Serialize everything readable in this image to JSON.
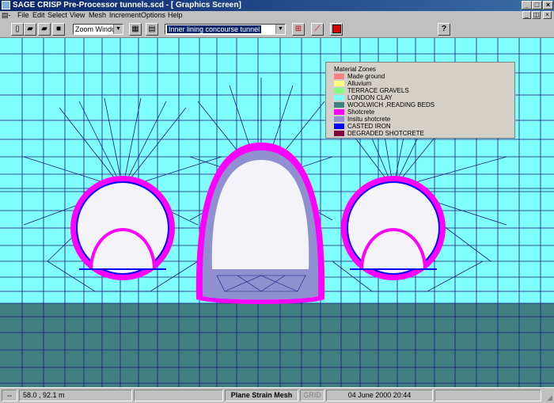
{
  "window": {
    "title": "SAGE CRISP Pre-Processor tunnels.scd - [ Graphics Screen]"
  },
  "menu": [
    "File",
    "Edit",
    "Select",
    "View",
    "Mesh",
    "Increment",
    "Options",
    "Help"
  ],
  "toolbar": {
    "zoom_value": "Zoom Window",
    "zone_value": "Inner lining concourse tunnel",
    "help_icon": "?"
  },
  "legend": {
    "title": "Material Zones",
    "items": [
      {
        "label": "Made ground",
        "color": "#ff8080"
      },
      {
        "label": "Alluvium",
        "color": "#ffff80"
      },
      {
        "label": "TERRACE GRAVELS",
        "color": "#80ff80"
      },
      {
        "label": "LONDON CLAY",
        "color": "#80ffff"
      },
      {
        "label": "WOOLWICH ,READING BEDS",
        "color": "#408080"
      },
      {
        "label": "Shotcrete",
        "color": "#ff00ff"
      },
      {
        "label": "Insitu shotcrete",
        "color": "#9090d0"
      },
      {
        "label": "CASTED IRON",
        "color": "#0000ff"
      },
      {
        "label": "DEGRADED SHOTCRETE",
        "color": "#800040"
      }
    ]
  },
  "status": {
    "coords": "58.0 , 92.1 m",
    "mode": "Plane Strain Mesh",
    "grid": "GRID",
    "date": "04 June 2000 20:44"
  },
  "colors": {
    "clay": "#80ffff",
    "woolwich": "#408080",
    "mesh": "#1a1a80",
    "interior": "#f4f4f8"
  }
}
